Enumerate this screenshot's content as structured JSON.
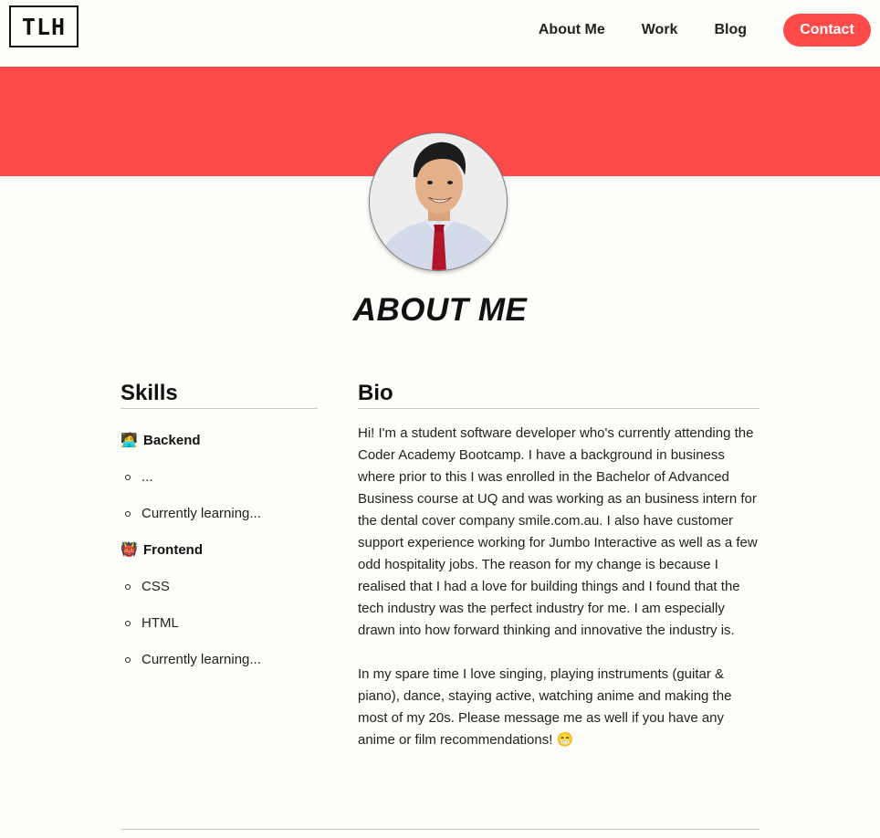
{
  "header": {
    "logo": "TLH",
    "nav": {
      "about": "About Me",
      "work": "Work",
      "blog": "Blog",
      "contact": "Contact"
    }
  },
  "colors": {
    "accent": "#ff4a4a",
    "background": "#fdfdfa",
    "text": "#222222"
  },
  "page_title": "ABOUT ME",
  "skills": {
    "heading": "Skills",
    "groups": [
      {
        "emoji": "🧑‍💻",
        "label": "Backend",
        "items": [
          "...",
          "Currently learning..."
        ]
      },
      {
        "emoji": "👹",
        "label": "Frontend",
        "items": [
          "CSS",
          "HTML",
          "Currently learning..."
        ]
      }
    ]
  },
  "bio": {
    "heading": "Bio",
    "paragraphs": [
      "Hi! I'm a student software developer who's currently attending the Coder Academy Bootcamp. I have a background in business where prior to this I was enrolled in the Bachelor of Advanced Business course at UQ and was working as an business intern for the dental cover company smile.com.au. I also have customer support experience working for Jumbo Interactive as well as a few odd hospitality jobs. The reason for my change is because I realised that I had a love for building things and I found that the tech industry was the perfect industry for me. I am especially drawn into how forward thinking and innovative the industry is.",
      "In my spare time I love singing, playing instruments (guitar & piano), dance, staying active, watching anime and making the most of my 20s. Please message me as well if you have any anime or film recommendations! 😁"
    ]
  }
}
